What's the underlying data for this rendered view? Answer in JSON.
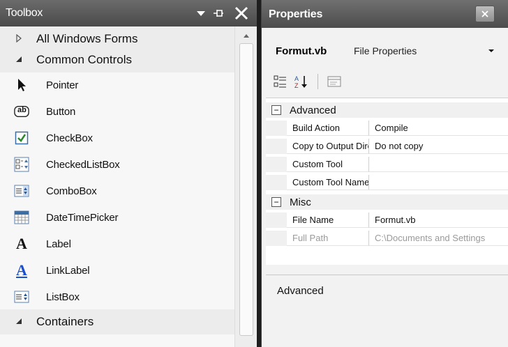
{
  "toolbox": {
    "title": "Toolbox",
    "buttons": {
      "dropdown_icon": "dropdown-arrow-icon",
      "pin_icon": "pin-icon",
      "close_icon": "close-icon"
    },
    "categories": {
      "all_windows_forms": "All Windows Forms",
      "common_controls": "Common Controls",
      "containers": "Containers"
    },
    "items": [
      {
        "label": "Pointer",
        "icon": "pointer-icon"
      },
      {
        "label": "Button",
        "icon": "button-icon"
      },
      {
        "label": "CheckBox",
        "icon": "checkbox-icon"
      },
      {
        "label": "CheckedListBox",
        "icon": "checkedlistbox-icon"
      },
      {
        "label": "ComboBox",
        "icon": "combobox-icon"
      },
      {
        "label": "DateTimePicker",
        "icon": "datetimepicker-icon"
      },
      {
        "label": "Label",
        "icon": "label-icon"
      },
      {
        "label": "LinkLabel",
        "icon": "linklabel-icon"
      },
      {
        "label": "ListBox",
        "icon": "listbox-icon"
      }
    ],
    "button_icon_glyph": "ab",
    "label_icon_glyph": "A"
  },
  "properties": {
    "title": "Properties",
    "object_name": "Formut.vb",
    "object_kind": "File Properties",
    "toolbar": {
      "categorized_icon": "categorized-icon",
      "alphabetical_icon": "sort-alpha-icon",
      "property_pages_icon": "property-pages-icon"
    },
    "grid": {
      "advanced": {
        "name": "Advanced",
        "toggle": "−",
        "rows": [
          {
            "name": "Build Action",
            "value": "Compile"
          },
          {
            "name": "Copy to Output Directory",
            "value": "Do not copy"
          },
          {
            "name": "Custom Tool",
            "value": ""
          },
          {
            "name": "Custom Tool Namespace",
            "value": ""
          }
        ]
      },
      "misc": {
        "name": "Misc",
        "toggle": "−",
        "rows": [
          {
            "name": "File Name",
            "value": "Formut.vb"
          },
          {
            "name": "Full Path",
            "value": "C:\\Documents and Settings"
          }
        ]
      }
    },
    "description": {
      "title": "Advanced"
    }
  },
  "colors": {
    "header_dark": "#4a4a4a",
    "checkbox_green": "#2b8a2b",
    "link_blue": "#1a4fd0"
  }
}
